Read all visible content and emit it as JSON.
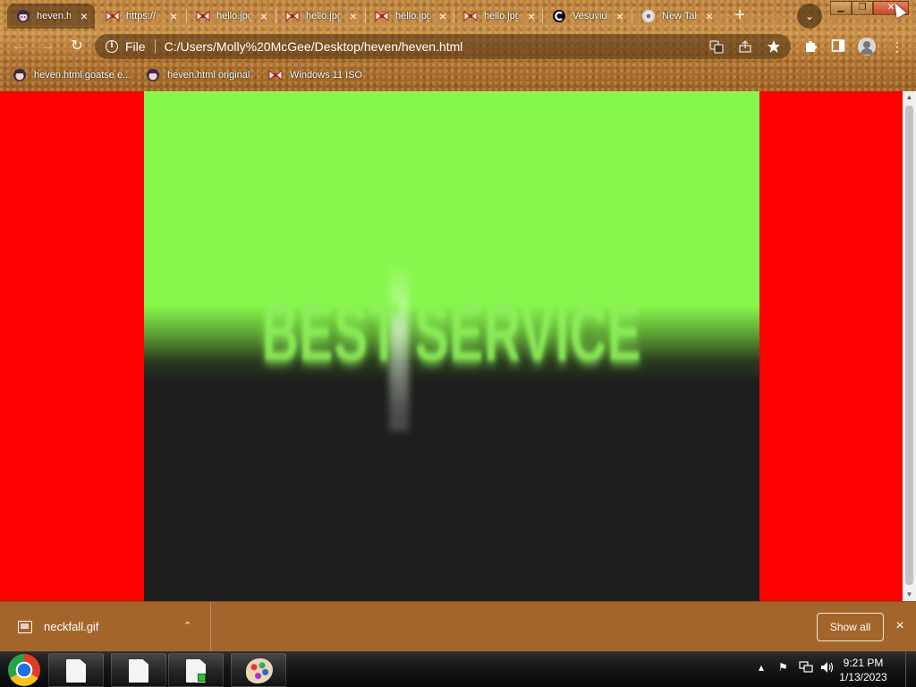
{
  "tabs": [
    {
      "title": "heven.html",
      "favicon": "anime-avatar-icon",
      "active": true
    },
    {
      "title": "https://",
      "favicon": "bow-icon",
      "active": false
    },
    {
      "title": "hello.jpg",
      "favicon": "bow-icon",
      "active": false
    },
    {
      "title": "hello.jpg",
      "favicon": "bow-icon",
      "active": false
    },
    {
      "title": "hello.jpg",
      "favicon": "bow-icon",
      "active": false
    },
    {
      "title": "hello.jpg",
      "favicon": "bow-icon",
      "active": false
    },
    {
      "title": "Vesuvius",
      "favicon": "c-logo-icon",
      "active": false
    },
    {
      "title": "New Tab",
      "favicon": "chrome-icon",
      "active": false
    }
  ],
  "toolbar": {
    "back_icon": "←",
    "forward_icon": "→",
    "reload_icon": "↻",
    "new_tab_icon": "+",
    "tab_search_icon": "⌄",
    "close_icon": "×"
  },
  "omnibox": {
    "scheme_label": "File",
    "url": "C:/Users/Molly%20McGee/Desktop/heven/heven.html"
  },
  "bookmarks": [
    {
      "label": "heven.html goatse e...",
      "favicon": "anime-avatar-icon"
    },
    {
      "label": "heven.html original",
      "favicon": "anime-avatar-icon"
    },
    {
      "label": "Windows 11 ISO",
      "favicon": "bow-icon"
    }
  ],
  "page": {
    "background_color": "#ff0000",
    "stage_text": "BEST SERVICE",
    "stage_top_color": "#87f84b",
    "stage_bottom_color": "#1e1e1e"
  },
  "download_shelf": {
    "file_name": "neckfall.gif",
    "show_all_label": "Show all",
    "caret_icon": "⌃"
  },
  "taskbar": {
    "time": "9:21 PM",
    "date": "1/13/2023"
  }
}
